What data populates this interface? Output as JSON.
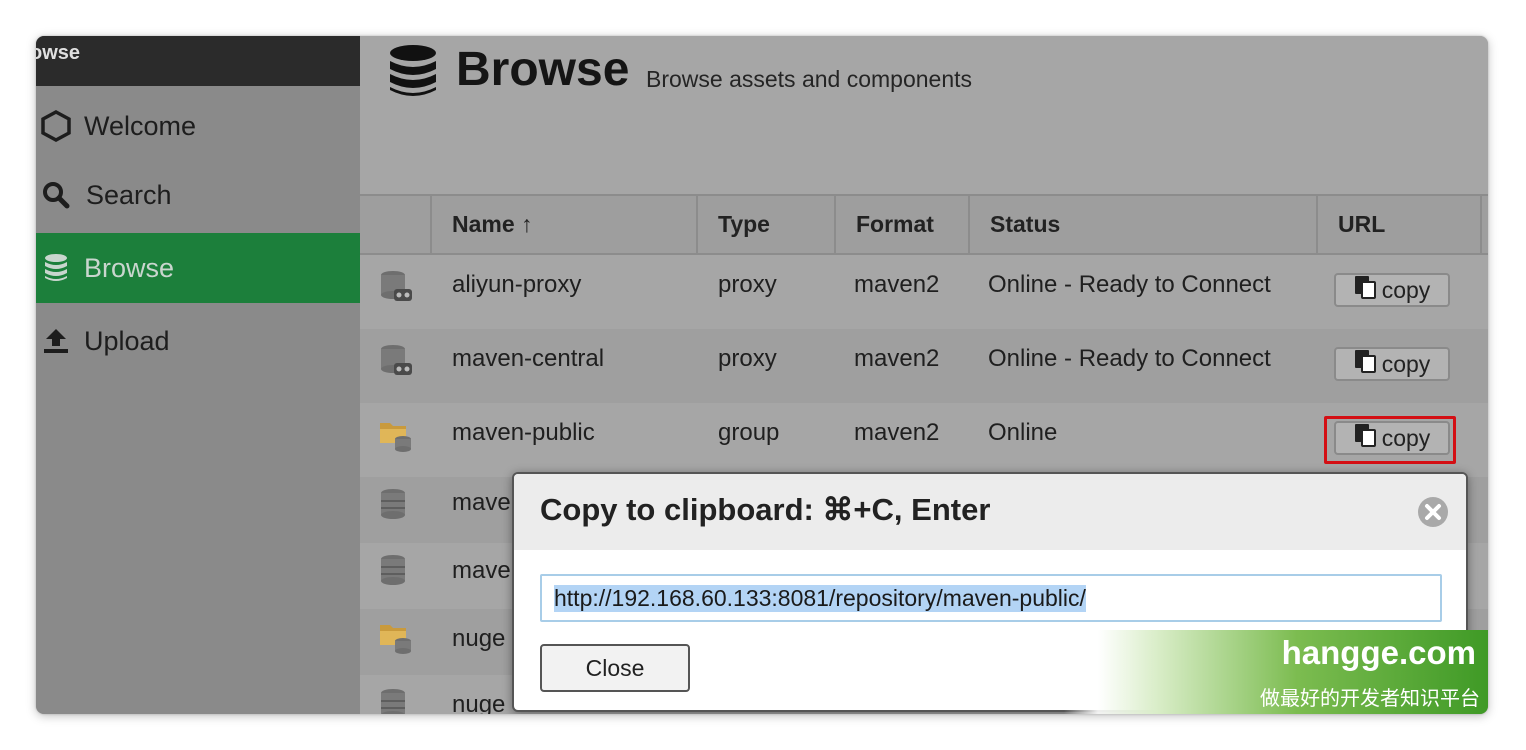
{
  "sidebar": {
    "header": "owse",
    "items": [
      {
        "label": "Welcome",
        "icon": "hexagon-icon",
        "active": false
      },
      {
        "label": "Search",
        "icon": "search-icon",
        "active": false
      },
      {
        "label": "Browse",
        "icon": "database-icon",
        "active": true
      },
      {
        "label": "Upload",
        "icon": "upload-icon",
        "active": false
      }
    ]
  },
  "page": {
    "title": "Browse",
    "subtitle": "Browse assets and components"
  },
  "grid": {
    "columns": {
      "name": "Name ↑",
      "type": "Type",
      "format": "Format",
      "status": "Status",
      "url": "URL"
    },
    "rows": [
      {
        "name": "aliyun-proxy",
        "type": "proxy",
        "format": "maven2",
        "status": "Online - Ready to Connect",
        "icon": "proxy-repo-icon"
      },
      {
        "name": "maven-central",
        "type": "proxy",
        "format": "maven2",
        "status": "Online - Ready to Connect",
        "icon": "proxy-repo-icon"
      },
      {
        "name": "maven-public",
        "type": "group",
        "format": "maven2",
        "status": "Online",
        "icon": "group-repo-icon"
      },
      {
        "name": "mave",
        "icon": "hosted-repo-icon"
      },
      {
        "name": "mave",
        "icon": "hosted-repo-icon"
      },
      {
        "name": "nuge",
        "icon": "group-repo-icon"
      },
      {
        "name": "nuge",
        "icon": "hosted-repo-icon"
      }
    ],
    "copy_label": "copy"
  },
  "dialog": {
    "title": "Copy to clipboard: ⌘+C, Enter",
    "url": "http://192.168.60.133:8081/repository/maven-public/",
    "close_label": "Close"
  },
  "watermark": {
    "main": "hangge.com",
    "sub": "做最好的开发者知识平台"
  },
  "colors": {
    "active_nav": "#1c7f3b",
    "highlight": "#d40f14",
    "selection": "#b3d4f5"
  }
}
